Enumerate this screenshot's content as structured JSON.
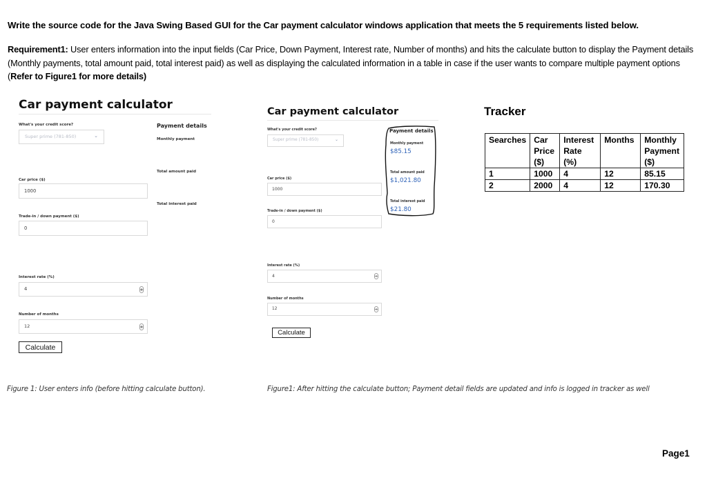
{
  "document": {
    "heading": "Write the source code for the Java Swing Based GUI for the Car payment calculator windows application that meets the 5 requirements listed below.",
    "requirement1": {
      "label": "Requirement1:",
      "text": " User enters information into the input fields (Car Price, Down Payment, Interest rate, Number of months) and hits the calculate button to display the Payment details (Monthly payments, total amount paid, total interest paid) as well as displaying the calculated information in a table in case if the user wants to compare multiple payment options (",
      "ref": "Refer to Figure1 for more details)"
    },
    "page_number": "Page1"
  },
  "figure_before": {
    "title": "Car payment calculator",
    "credit_score_label": "What's your credit score?",
    "credit_score_value": "Super prime (781-850)",
    "car_price_label": "Car price ($)",
    "car_price_value": "1000",
    "down_payment_label": "Trade-in / down payment ($)",
    "down_payment_value": "0",
    "interest_rate_label": "Interest rate (%)",
    "interest_rate_value": "4",
    "months_label": "Number of months",
    "months_value": "12",
    "calculate_label": "Calculate",
    "payment_details": {
      "title": "Payment details",
      "monthly_label": "Monthly payment",
      "total_paid_label": "Total amount paid",
      "total_interest_label": "Total interest paid"
    },
    "caption": "Figure 1: User enters info (before hitting calculate button)."
  },
  "figure_after": {
    "title": "Car payment calculator",
    "credit_score_label": "What's your credit score?",
    "credit_score_value": "Super prime (781-850)",
    "car_price_label": "Car price ($)",
    "car_price_value": "1000",
    "down_payment_label": "Trade-in / down payment ($)",
    "down_payment_value": "0",
    "interest_rate_label": "Interest rate (%)",
    "interest_rate_value": "4",
    "months_label": "Number of months",
    "months_value": "12",
    "calculate_label": "Calculate",
    "payment_details": {
      "title": "Payment details",
      "monthly_label": "Monthly payment",
      "monthly_value": "$85.15",
      "total_paid_label": "Total amount paid",
      "total_paid_value": "$1,021.80",
      "total_interest_label": "Total interest paid",
      "total_interest_value": "$21.80"
    },
    "caption": "Figure1: After hitting the calculate button; Payment detail fields are updated and info is logged in tracker as well"
  },
  "tracker": {
    "title": "Tracker",
    "headers": [
      [
        "Searches"
      ],
      [
        "Car",
        "Price",
        "($)"
      ],
      [
        "Interest",
        "Rate",
        "(%)"
      ],
      [
        "Months"
      ],
      [
        "Monthly",
        "Payment",
        "($)"
      ]
    ],
    "rows": [
      [
        "1",
        "1000",
        "4",
        "12",
        "85.15"
      ],
      [
        "2",
        "2000",
        "4",
        "12",
        "170.30"
      ]
    ]
  },
  "colors": {
    "accent_value": "#2f63b8",
    "field_border": "#d9d9d9",
    "placeholder": "#b8bcc6"
  },
  "icons": {
    "dropdown": "chevron-down-icon",
    "spinner": "spinner-icon"
  }
}
